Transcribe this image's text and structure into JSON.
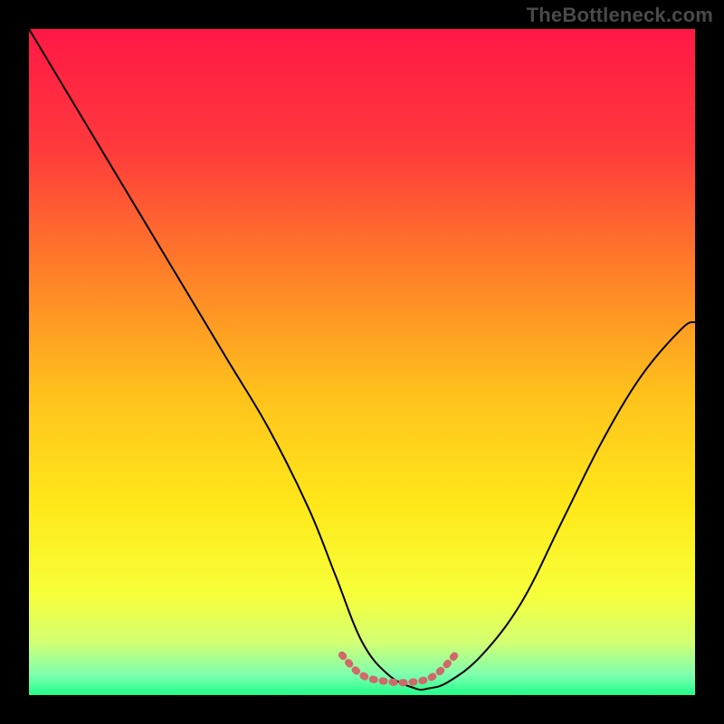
{
  "watermark": "TheBottleneck.com",
  "gradient_stops": [
    {
      "offset": 0.0,
      "color": "#ff1846"
    },
    {
      "offset": 0.18,
      "color": "#ff3a3c"
    },
    {
      "offset": 0.35,
      "color": "#ff7a2a"
    },
    {
      "offset": 0.55,
      "color": "#ffc21c"
    },
    {
      "offset": 0.72,
      "color": "#ffe91a"
    },
    {
      "offset": 0.85,
      "color": "#f6ff3a"
    },
    {
      "offset": 0.92,
      "color": "#d4ff72"
    },
    {
      "offset": 0.97,
      "color": "#7dffb0"
    },
    {
      "offset": 1.0,
      "color": "#22ff88"
    }
  ],
  "chart_data": {
    "type": "line",
    "title": "",
    "xlabel": "",
    "ylabel": "",
    "xlim": [
      0,
      100
    ],
    "ylim": [
      0,
      100
    ],
    "series": [
      {
        "name": "bottleneck-curve",
        "x": [
          0,
          6,
          12,
          18,
          24,
          30,
          36,
          42,
          46,
          50,
          54,
          58,
          60,
          63,
          68,
          74,
          80,
          86,
          92,
          98,
          100
        ],
        "values": [
          100,
          90,
          80,
          70,
          60,
          50,
          40,
          28,
          18,
          8,
          3,
          1,
          1,
          2,
          6,
          14,
          26,
          38,
          48,
          55,
          56
        ]
      },
      {
        "name": "sweet-spot-band",
        "x": [
          47,
          50,
          54,
          58,
          61,
          64
        ],
        "values": [
          6,
          3,
          2,
          2,
          3,
          6
        ]
      }
    ],
    "annotations": []
  },
  "curve_style": {
    "stroke": "#000000",
    "stroke_width": 2.0
  },
  "band_style": {
    "stroke": "#d06a6a",
    "stroke_width": 8,
    "dash": "2 9",
    "linecap": "round"
  }
}
